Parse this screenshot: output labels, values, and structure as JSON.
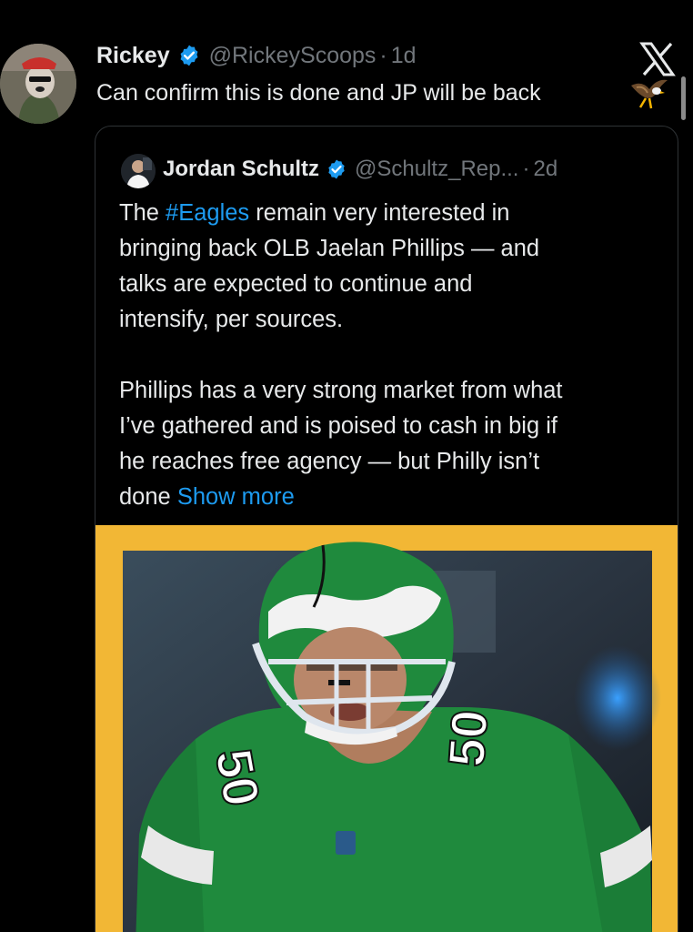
{
  "tweet": {
    "display_name": "Rickey",
    "handle": "@RickeyScoops",
    "separator": "·",
    "time": "1d",
    "text": "Can confirm this is done and JP will be back",
    "emoji": "eagle-emoji"
  },
  "quote": {
    "display_name": "Jordan Schultz",
    "handle": "@Schultz_Rep...",
    "separator": "·",
    "time": "2d",
    "p1_before": "The ",
    "hashtag": "#Eagles",
    "p1_l1_after": " remain very interested in",
    "p1_l2": "bringing back OLB Jaelan Phillips — and",
    "p1_l3": "talks are expected to continue and",
    "p1_l4": "intensify, per sources.",
    "p2_l1": "Phillips has a very strong market from what",
    "p2_l2": "I’ve gathered and is poised to cash in big if",
    "p2_l3": "he reaches free agency — but Philly isn’t",
    "p2_l4_before": "done ",
    "show_more": "Show more"
  },
  "media": {
    "subject": "football-player-photo",
    "jersey_number": "50",
    "frame_color": "#f2b735",
    "jersey_color": "#1f8a3d"
  },
  "colors": {
    "background": "#000000",
    "text_primary": "#e7e9ea",
    "text_secondary": "#71767b",
    "link": "#1d9bf0",
    "verified": "#1d9bf0"
  }
}
